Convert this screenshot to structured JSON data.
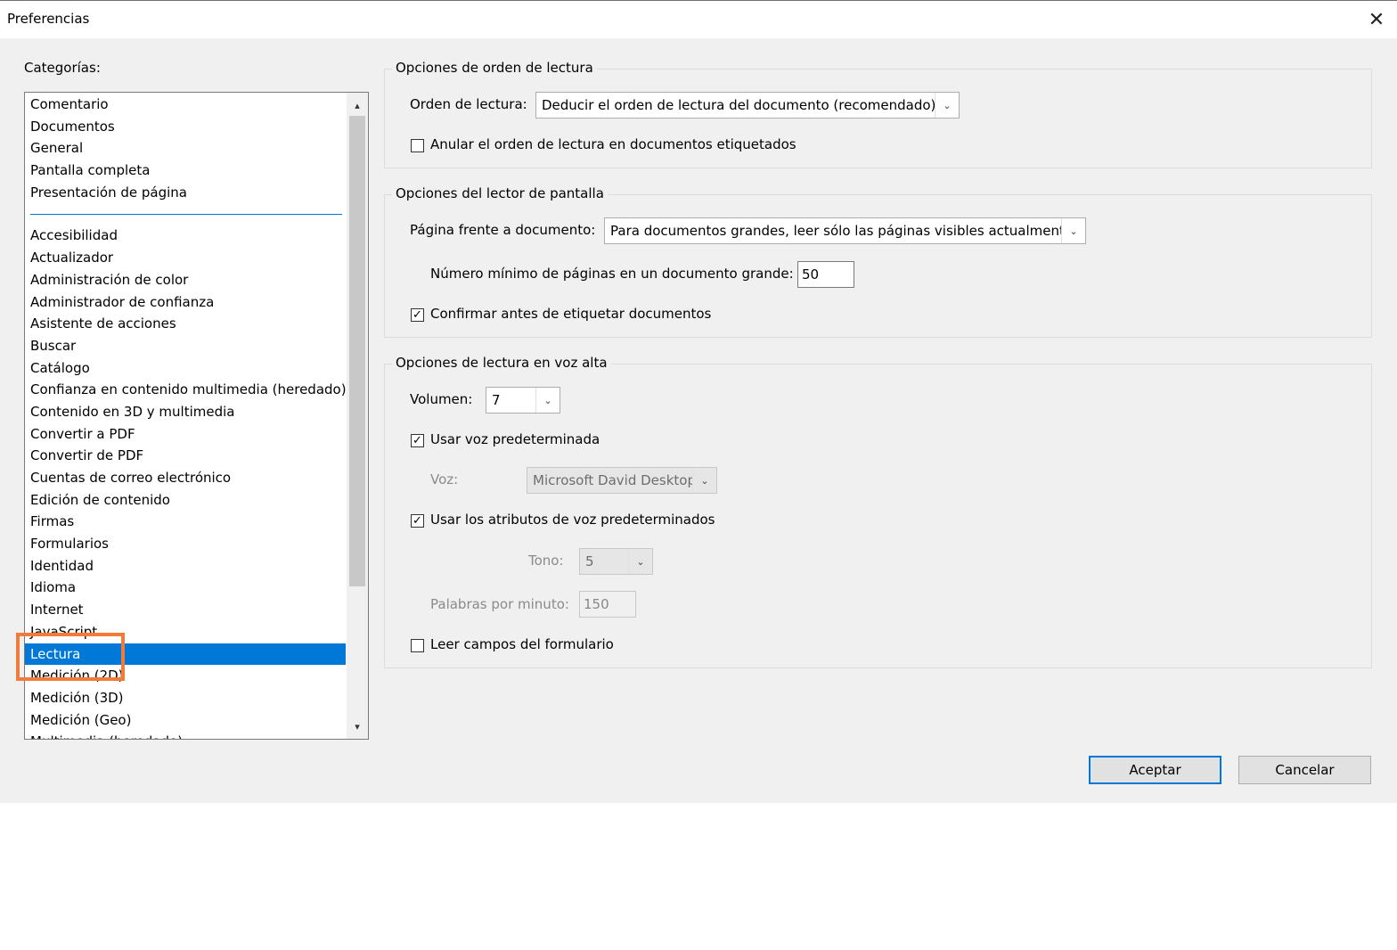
{
  "window": {
    "title": "Preferencias",
    "close_glyph": "✕"
  },
  "categories": {
    "label": "Categorías:",
    "top_items": [
      "Comentario",
      "Documentos",
      "General",
      "Pantalla completa",
      "Presentación de página"
    ],
    "items": [
      "Accesibilidad",
      "Actualizador",
      "Administración de color",
      "Administrador de confianza",
      "Asistente de acciones",
      "Buscar",
      "Catálogo",
      "Confianza en contenido multimedia (heredado)",
      "Contenido en 3D y multimedia",
      "Convertir a PDF",
      "Convertir de PDF",
      "Cuentas de correo electrónico",
      "Edición de contenido",
      "Firmas",
      "Formularios",
      "Identidad",
      "Idioma",
      "Internet",
      "JavaScript",
      "Lectura",
      "Medición (2D)",
      "Medición (3D)",
      "Medición (Geo)",
      "Multimedia (heredado)"
    ],
    "selected": "Lectura"
  },
  "reading_order": {
    "legend": "Opciones de orden de lectura",
    "order_label": "Orden de lectura:",
    "order_value": "Deducir el orden de lectura del documento (recomendado)",
    "override_label": "Anular el orden de lectura en documentos etiquetados",
    "override_checked": false
  },
  "screen_reader": {
    "legend": "Opciones del lector de pantalla",
    "page_label": "Página frente a documento:",
    "page_value": "Para documentos grandes, leer sólo las páginas visibles actualmente",
    "min_pages_label": "Número mínimo de páginas en un documento grande:",
    "min_pages_value": "50",
    "confirm_label": "Confirmar antes de etiquetar documentos",
    "confirm_checked": true
  },
  "read_aloud": {
    "legend": "Opciones de lectura en voz alta",
    "volume_label": "Volumen:",
    "volume_value": "7",
    "default_voice_label": "Usar voz predeterminada",
    "default_voice_checked": true,
    "voice_label": "Voz:",
    "voice_value": "Microsoft David Desktop",
    "default_attrs_label": "Usar los atributos de voz predeterminados",
    "default_attrs_checked": true,
    "pitch_label": "Tono:",
    "pitch_value": "5",
    "wpm_label": "Palabras por minuto:",
    "wpm_value": "150",
    "form_fields_label": "Leer campos del formulario",
    "form_fields_checked": false
  },
  "buttons": {
    "ok": "Aceptar",
    "cancel": "Cancelar"
  },
  "glyphs": {
    "check": "✓",
    "down": "▾",
    "up": "▴",
    "combo_arrow": "⌄"
  },
  "colors": {
    "selection": "#0078d7",
    "highlight_box": "#f07b3b"
  }
}
